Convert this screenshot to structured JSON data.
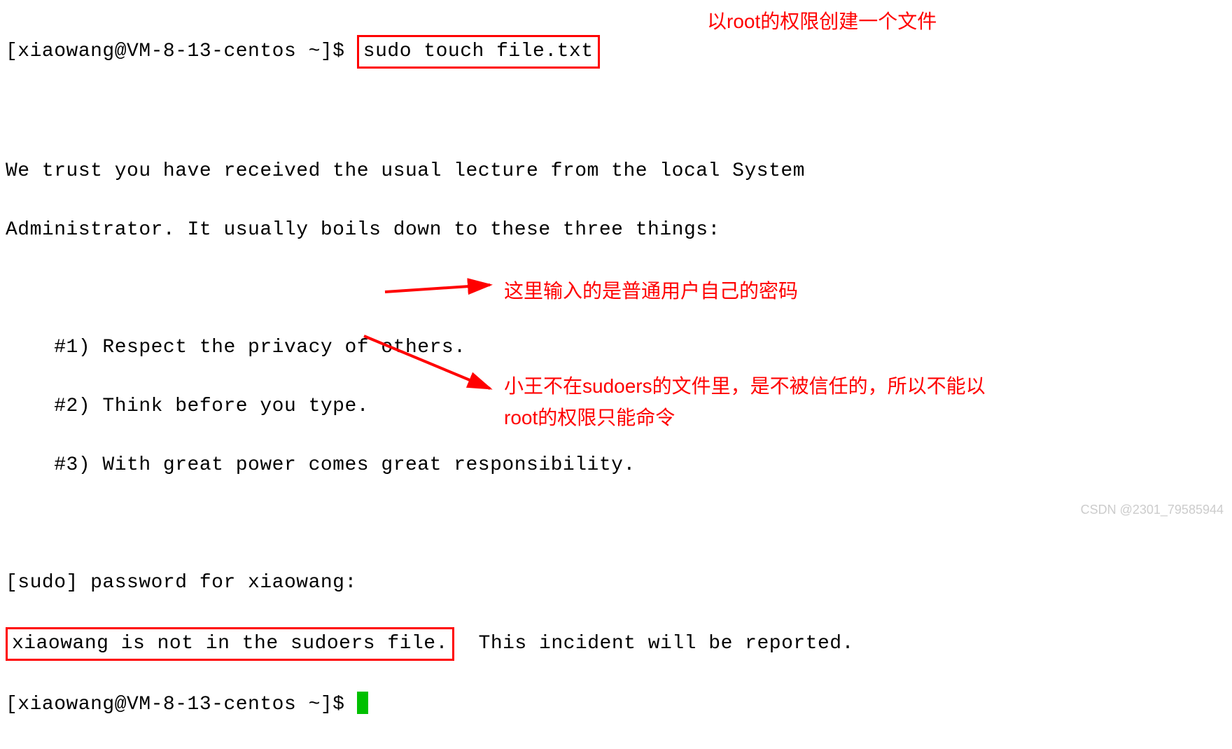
{
  "terminal": {
    "prompt1_prefix": "[xiaowang@VM-8-13-centos ~]$ ",
    "command1": "sudo touch file.txt",
    "lecture_line1": "We trust you have received the usual lecture from the local System",
    "lecture_line2": "Administrator. It usually boils down to these three things:",
    "rule1": "    #1) Respect the privacy of others.",
    "rule2": "    #2) Think before you type.",
    "rule3": "    #3) With great power comes great responsibility.",
    "password_prompt": "[sudo] password for xiaowang:",
    "error_boxed": "xiaowang is not in the sudoers file.",
    "error_rest": "  This incident will be reported.",
    "prompt2_prefix": "[xiaowang@VM-8-13-centos ~]$ "
  },
  "annotations": {
    "anno1": "以root的权限创建一个文件",
    "anno2": "这里输入的是普通用户自己的密码",
    "anno3": "小王不在sudoers的文件里，是不被信任的，所以不能以root的权限只能命令"
  },
  "watermark": "CSDN @2301_79585944"
}
